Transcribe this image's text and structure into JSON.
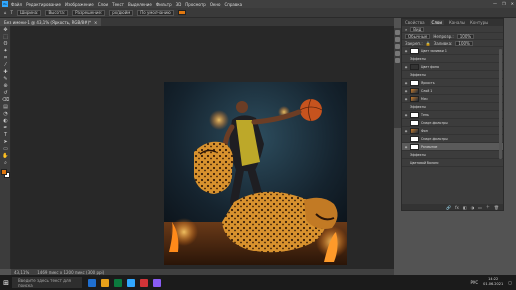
{
  "menubar": {
    "app_icon": "Ps",
    "items": [
      "Файл",
      "Редактирование",
      "Изображение",
      "Слои",
      "Текст",
      "Выделение",
      "Фильтр",
      "3D",
      "Просмотр",
      "Окно",
      "Справка"
    ],
    "window_controls": [
      "—",
      "❐",
      "✕"
    ]
  },
  "options_bar": {
    "fields": [
      "Ширина:",
      "Высота:",
      "Разрешение:",
      "px/дюйм"
    ],
    "button": "По умолчанию",
    "color_swatch": "#e07810"
  },
  "document_tab": {
    "title": "Без имени-1 @ 43,1% (Яркость, RGB/8#)*",
    "close": "×"
  },
  "toolbar": {
    "tools": [
      "move-icon",
      "marquee-icon",
      "lasso-icon",
      "wand-icon",
      "crop-icon",
      "eyedropper-icon",
      "heal-icon",
      "brush-icon",
      "stamp-icon",
      "history-icon",
      "eraser-icon",
      "gradient-icon",
      "blur-icon",
      "dodge-icon",
      "pen-icon",
      "type-icon",
      "path-select-icon",
      "shape-icon",
      "hand-icon",
      "zoom-icon"
    ],
    "tool_glyphs": [
      "✥",
      "⬚",
      "ʘ",
      "✦",
      "⌗",
      "⁄",
      "✚",
      "✎",
      "⊕",
      "↺",
      "⌫",
      "▤",
      "◔",
      "◐",
      "✒",
      "T",
      "➤",
      "▭",
      "✋",
      "⌕"
    ],
    "foreground_color": "#e07810",
    "background_color": "#ffffff"
  },
  "status": {
    "zoom": "43,11%",
    "doc_info": "1469 пикс x 1200 пикс (300 ppi)"
  },
  "layers_panel": {
    "tabs": [
      "Свойства",
      "Слои",
      "Каналы",
      "Контуры"
    ],
    "active_tab": "Слои",
    "filter_label": "Вид",
    "blend_mode": "Обычные",
    "opacity_label": "Непрозр.:",
    "opacity": "100%",
    "lock_label": "Закреп.:",
    "fill_label": "Заливка:",
    "fill": "100%",
    "layers": [
      {
        "name": "Цвет заливки 1",
        "thumb": "white",
        "indent": false,
        "selected": false
      },
      {
        "name": "Эффекты",
        "thumb": "none",
        "indent": true,
        "selected": false
      },
      {
        "name": "Цвет фона",
        "thumb": "dark",
        "indent": false,
        "selected": false
      },
      {
        "name": "Эффекты",
        "thumb": "none",
        "indent": true,
        "selected": false
      },
      {
        "name": "Яркость",
        "thumb": "white",
        "indent": false,
        "selected": false
      },
      {
        "name": "Слой 1",
        "thumb": "img",
        "indent": false,
        "selected": false
      },
      {
        "name": "Мяч",
        "thumb": "img",
        "indent": false,
        "selected": false
      },
      {
        "name": "Эффекты",
        "thumb": "none",
        "indent": true,
        "selected": false
      },
      {
        "name": "Тень",
        "thumb": "white",
        "indent": false,
        "selected": false
      },
      {
        "name": "Смарт-фильтры",
        "thumb": "white",
        "indent": true,
        "selected": false
      },
      {
        "name": "Фон",
        "thumb": "img",
        "indent": false,
        "selected": false
      },
      {
        "name": "Смарт-фильтры",
        "thumb": "white",
        "indent": true,
        "selected": false
      },
      {
        "name": "Размытие",
        "thumb": "white",
        "indent": false,
        "selected": true
      },
      {
        "name": "Эффекты",
        "thumb": "none",
        "indent": true,
        "selected": false
      },
      {
        "name": "Цветовой баланс",
        "thumb": "none",
        "indent": true,
        "selected": false
      }
    ],
    "footer_icons": [
      "🔗",
      "fx",
      "◧",
      "◑",
      "▭",
      "＋",
      "🗑"
    ]
  },
  "taskbar": {
    "search_placeholder": "Введите здесь текст для поиска",
    "app_colors": [
      "#1f6fd0",
      "#e8a11a",
      "#0b7a3e",
      "#31a8ff",
      "#d13438",
      "#8a5cf5"
    ],
    "time": "14:22",
    "date": "01.06.2021",
    "lang": "РУС"
  }
}
